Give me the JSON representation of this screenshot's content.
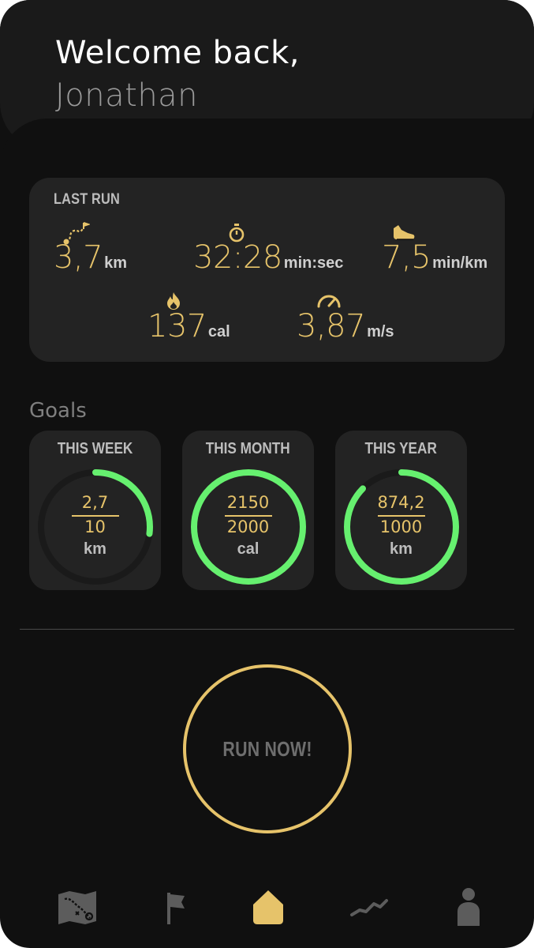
{
  "header": {
    "greeting": "Welcome back,",
    "user_name": "Jonathan"
  },
  "last_run": {
    "title": "LAST RUN",
    "stats": [
      {
        "icon": "route-icon",
        "value": "3,7",
        "unit": "km"
      },
      {
        "icon": "stopwatch-icon",
        "value": "32:28",
        "unit": "min:sec"
      },
      {
        "icon": "shoe-icon",
        "value": "7,5",
        "unit": "min/km"
      },
      {
        "icon": "flame-icon",
        "value": "137",
        "unit": "cal"
      },
      {
        "icon": "speedometer-icon",
        "value": "3,87",
        "unit": "m/s"
      }
    ]
  },
  "goals": {
    "label": "Goals",
    "cards": [
      {
        "title": "THIS WEEK",
        "current": "2,7",
        "target": "10",
        "unit": "km",
        "progress": 0.27
      },
      {
        "title": "THIS MONTH",
        "current": "2150",
        "target": "2000",
        "unit": "cal",
        "progress": 1.0
      },
      {
        "title": "THIS YEAR",
        "current": "874,2",
        "target": "1000",
        "unit": "km",
        "progress": 0.874
      }
    ]
  },
  "run_button": {
    "label": "RUN NOW!"
  },
  "nav": {
    "items": [
      {
        "icon": "map-icon",
        "active": false
      },
      {
        "icon": "flag-icon",
        "active": false
      },
      {
        "icon": "home-icon",
        "active": true
      },
      {
        "icon": "stats-icon",
        "active": false
      },
      {
        "icon": "profile-icon",
        "active": false
      }
    ]
  },
  "colors": {
    "accent": "#e6c36a",
    "progress": "#66f06f",
    "background": "#101010",
    "card": "#232323"
  }
}
